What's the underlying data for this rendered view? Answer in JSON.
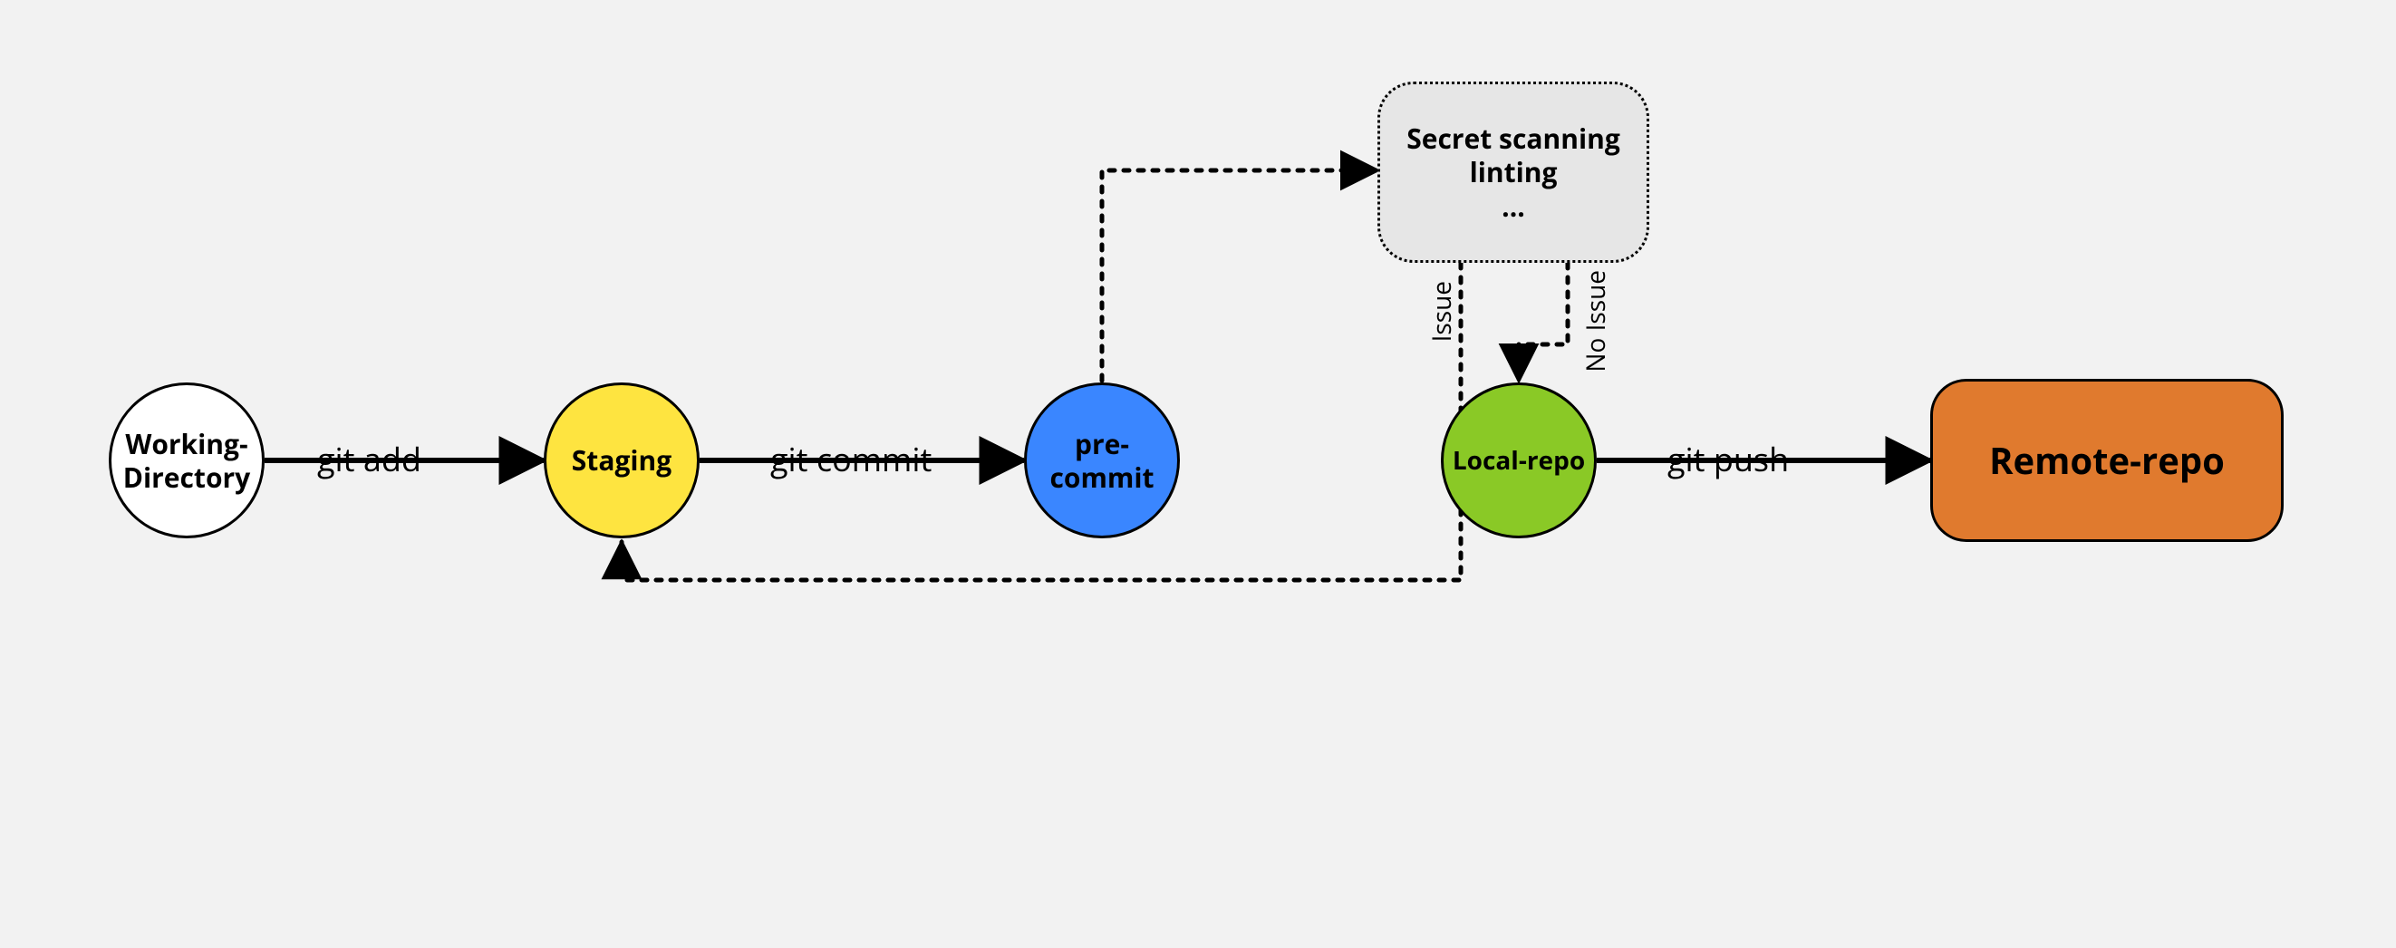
{
  "nodes": {
    "working_directory": "Working-\nDirectory",
    "staging": "Staging",
    "pre_commit": "pre-\ncommit",
    "local_repo": "Local-repo",
    "remote_repo": "Remote-repo",
    "checks_line1": "Secret scanning",
    "checks_line2": "linting",
    "checks_line3": "..."
  },
  "edges": {
    "git_add": "git add",
    "git_commit": "git commit",
    "git_push": "git push",
    "issue": "Issue",
    "no_issue": "No Issue"
  },
  "chart_data": {
    "type": "diagram",
    "title": "Git pre-commit hook workflow",
    "nodes": [
      {
        "id": "working_directory",
        "label": "Working-Directory",
        "shape": "circle",
        "fill": "#ffffff"
      },
      {
        "id": "staging",
        "label": "Staging",
        "shape": "circle",
        "fill": "#fee440"
      },
      {
        "id": "pre_commit",
        "label": "pre-commit",
        "shape": "circle",
        "fill": "#3a86ff"
      },
      {
        "id": "checks",
        "label": "Secret scanning / linting / ...",
        "shape": "rounded-rect-dotted",
        "fill": "#e6e6e6"
      },
      {
        "id": "local_repo",
        "label": "Local-repo",
        "shape": "circle",
        "fill": "#8ac926"
      },
      {
        "id": "remote_repo",
        "label": "Remote-repo",
        "shape": "rounded-rect",
        "fill": "#e07a2e"
      }
    ],
    "edges": [
      {
        "from": "working_directory",
        "to": "staging",
        "label": "git add",
        "style": "solid"
      },
      {
        "from": "staging",
        "to": "pre_commit",
        "label": "git commit",
        "style": "solid"
      },
      {
        "from": "pre_commit",
        "to": "checks",
        "label": "",
        "style": "dotted"
      },
      {
        "from": "checks",
        "to": "local_repo",
        "label": "No Issue",
        "style": "dotted"
      },
      {
        "from": "checks",
        "to": "staging",
        "label": "Issue",
        "style": "dotted"
      },
      {
        "from": "local_repo",
        "to": "remote_repo",
        "label": "git push",
        "style": "solid"
      }
    ]
  }
}
